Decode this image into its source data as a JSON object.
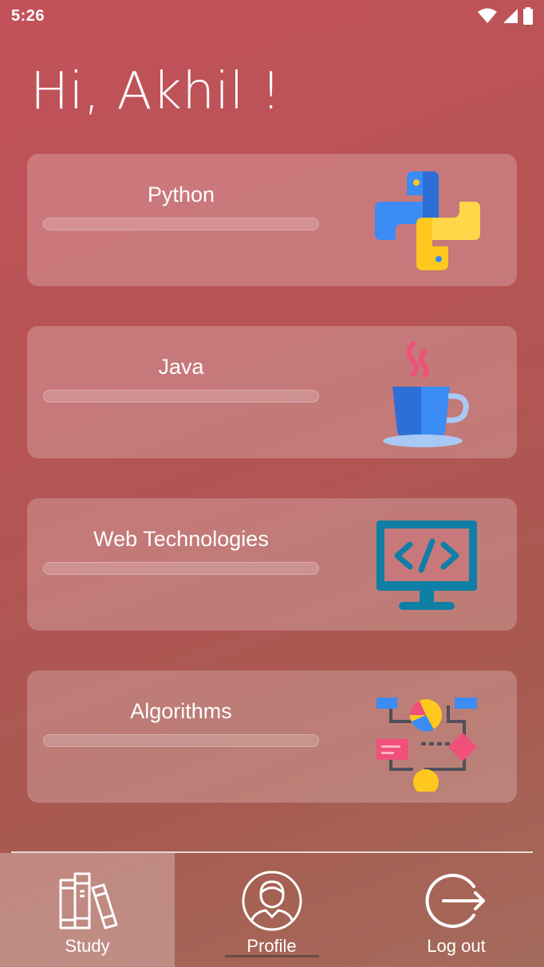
{
  "status_bar": {
    "time": "5:26",
    "icons": [
      "wifi-icon",
      "signal-icon",
      "battery-icon"
    ]
  },
  "greeting": "Hi, Akhil !",
  "courses": [
    {
      "title": "Python",
      "icon": "python-icon",
      "progress": 0
    },
    {
      "title": "Java",
      "icon": "java-coffee-icon",
      "progress": 0
    },
    {
      "title": "Web Technologies",
      "icon": "web-code-monitor-icon",
      "progress": 0
    },
    {
      "title": "Algorithms",
      "icon": "algorithm-flowchart-icon",
      "progress": 0
    }
  ],
  "bottom_nav": {
    "items": [
      {
        "label": "Study",
        "icon": "books-icon",
        "active": true
      },
      {
        "label": "Profile",
        "icon": "user-profile-icon",
        "active": false
      },
      {
        "label": "Log out",
        "icon": "logout-icon",
        "active": false
      }
    ]
  },
  "colors": {
    "background_top": "#c2525a",
    "background_bottom": "#a46b5c",
    "python_blue": "#3b8cf5",
    "python_yellow": "#fec81e",
    "web_teal": "#0f7fa6",
    "java_pink": "#f0507a"
  }
}
